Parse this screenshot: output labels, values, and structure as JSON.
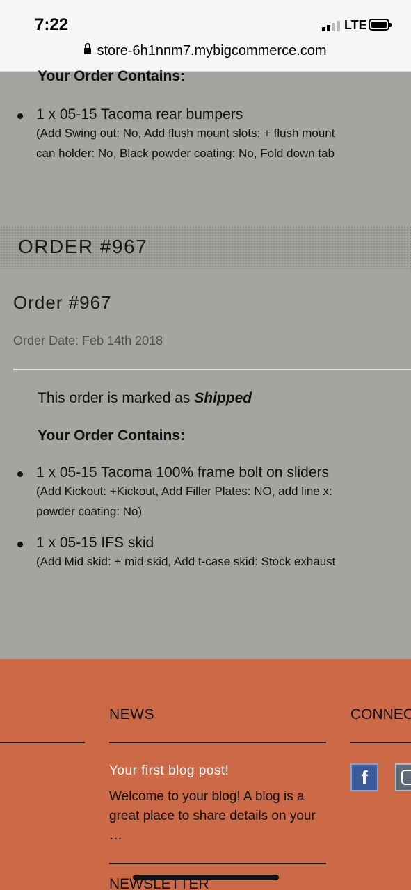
{
  "status_bar": {
    "time": "7:22",
    "network": "LTE"
  },
  "browser": {
    "url": "store-6h1nnm7.mybigcommerce.com"
  },
  "previous_order": {
    "contains_heading": "Your Order Contains:",
    "items": [
      {
        "name": "1 x 05-15 Tacoma rear bumpers",
        "options_line1": "(Add Swing out: No, Add flush mount slots: + flush mount",
        "options_line2": "can holder: No, Black powder coating: No, Fold down tab"
      }
    ]
  },
  "order": {
    "band_title": "ORDER #967",
    "title": "Order #967",
    "date": "Order Date: Feb 14th 2018",
    "status_prefix": "This order is marked as ",
    "status_value": "Shipped",
    "contains_heading": "Your Order Contains:",
    "items": [
      {
        "name": "1 x 05-15 Tacoma 100% frame bolt on sliders",
        "options_line1": "(Add Kickout: +Kickout, Add Filler Plates: NO, add line x:",
        "options_line2": "powder coating: No)"
      },
      {
        "name": "1 x 05-15 IFS skid",
        "options_line1": "(Add Mid skid: + mid skid, Add t-case skid: Stock exhaust",
        "options_line2": ""
      }
    ]
  },
  "footer": {
    "news_heading": "NEWS",
    "connect_heading": "CONNECT",
    "post_title": "Your first blog post!",
    "post_excerpt": "Welcome to your blog! A blog is a great place to share details on your …",
    "newsletter_heading": "NEWSLETTER",
    "facebook_glyph": "f",
    "colors": {
      "footer_bg": "#cc6a47",
      "page_bg": "#a4a4a0"
    }
  }
}
